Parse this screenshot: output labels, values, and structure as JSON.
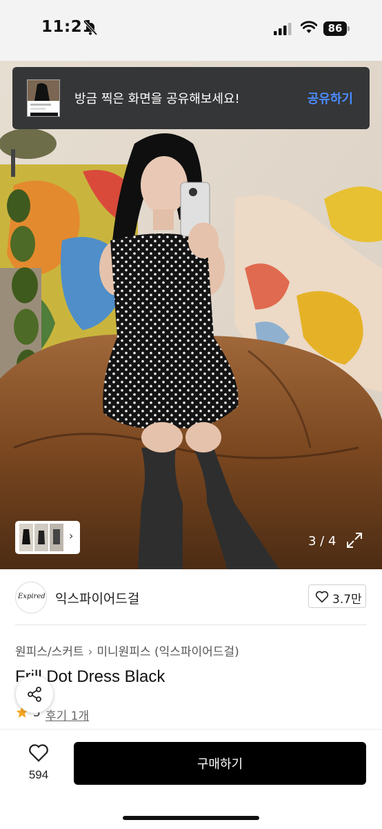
{
  "status_bar": {
    "time": "11:21",
    "battery": "86"
  },
  "toast": {
    "message": "방금 찍은 화면을 공유해보세요!",
    "action": "공유하기"
  },
  "gallery": {
    "counter": "3 / 4"
  },
  "seller": {
    "name": "익스파이어드걸",
    "logo_text": "Expired girl",
    "likes": "3.7만"
  },
  "product": {
    "breadcrumb": [
      "원피스/스커트",
      "미니원피스 (익스파이어드걸)"
    ],
    "title": "Frill Dot Dress Black",
    "rating": "5",
    "reviews": "후기 1개"
  },
  "bottom_bar": {
    "wish_count": "594",
    "buy_label": "구매하기"
  },
  "colors": {
    "accent_blue": "#4a8cff",
    "buy_button": "#000000",
    "star": "#f5a623"
  },
  "icons": [
    "bell-slash-icon",
    "signal-icon",
    "wifi-icon",
    "battery-icon",
    "chevron-right-icon",
    "expand-icon",
    "heart-icon",
    "share-icon",
    "star-icon"
  ]
}
